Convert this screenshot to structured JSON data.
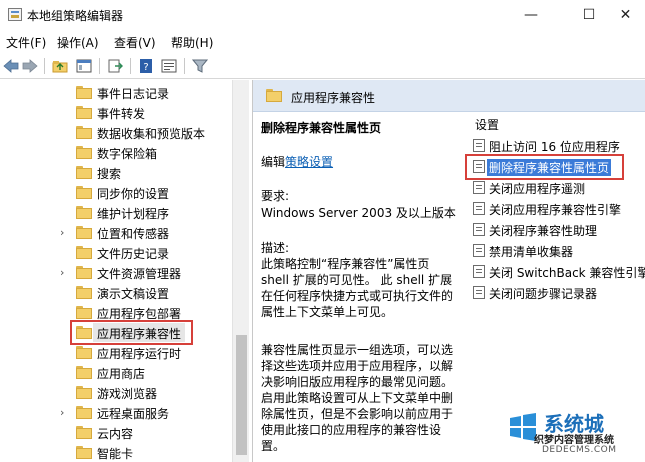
{
  "window": {
    "title": "本地组策略编辑器",
    "min_glyph": "—",
    "max_glyph": "☐",
    "close_glyph": "✕"
  },
  "menu": [
    "文件(F)",
    "操作(A)",
    "查看(V)",
    "帮助(H)"
  ],
  "tree": {
    "items": [
      {
        "label": "事件日志记录",
        "arrow": false
      },
      {
        "label": "事件转发",
        "arrow": false
      },
      {
        "label": "数据收集和预览版本",
        "arrow": false
      },
      {
        "label": "数字保险箱",
        "arrow": false
      },
      {
        "label": "搜索",
        "arrow": false
      },
      {
        "label": "同步你的设置",
        "arrow": false
      },
      {
        "label": "维护计划程序",
        "arrow": false
      },
      {
        "label": "位置和传感器",
        "arrow": true
      },
      {
        "label": "文件历史记录",
        "arrow": false
      },
      {
        "label": "文件资源管理器",
        "arrow": true
      },
      {
        "label": "演示文稿设置",
        "arrow": false
      },
      {
        "label": "应用程序包部署",
        "arrow": false
      },
      {
        "label": "应用程序兼容性",
        "arrow": false,
        "selected": true
      },
      {
        "label": "应用程序运行时",
        "arrow": false
      },
      {
        "label": "应用商店",
        "arrow": false
      },
      {
        "label": "游戏浏览器",
        "arrow": false
      },
      {
        "label": "远程桌面服务",
        "arrow": true
      },
      {
        "label": "云内容",
        "arrow": false
      },
      {
        "label": "智能卡",
        "arrow": false
      }
    ]
  },
  "right": {
    "header_title": "应用程序兼容性",
    "policy_name": "删除程序兼容性属性页",
    "edit_prefix": "编辑",
    "edit_link": "策略设置",
    "requirements_title": "要求:",
    "requirements_value": "Windows Server 2003 及以上版本",
    "description_title": "描述:",
    "description_p1": "此策略控制“程序兼容性”属性页 shell 扩展的可见性。 此 shell 扩展在任何程序快捷方式或可执行文件的属性上下文菜单上可见。",
    "description_p2": "兼容性属性页显示一组选项，可以选择这些选项并应用于应用程序，以解决影响旧版应用程序的最常见问题。启用此策略设置可从上下文菜单中删除属性页，但是不会影响以前应用于使用此接口的应用程序的兼容性设置。",
    "settings_title": "设置",
    "settings": [
      {
        "label": "阻止访问 16 位应用程序"
      },
      {
        "label": "删除程序兼容性属性页",
        "selected": true
      },
      {
        "label": "关闭应用程序遥测"
      },
      {
        "label": "关闭应用程序兼容性引擎"
      },
      {
        "label": "关闭程序兼容性助理"
      },
      {
        "label": "禁用清单收集器"
      },
      {
        "label": "关闭 SwitchBack 兼容性引擎"
      },
      {
        "label": "关闭问题步骤记录器"
      }
    ]
  },
  "watermark": {
    "brand": "系统城",
    "sub": "织梦内容管理系统",
    "url": "DEDECMS.COM"
  },
  "colors": {
    "highlight_red": "#d6403a",
    "selection_blue": "#3b7bd8",
    "header_bg": "#dfe8f4",
    "link_blue": "#0b5fb4"
  }
}
